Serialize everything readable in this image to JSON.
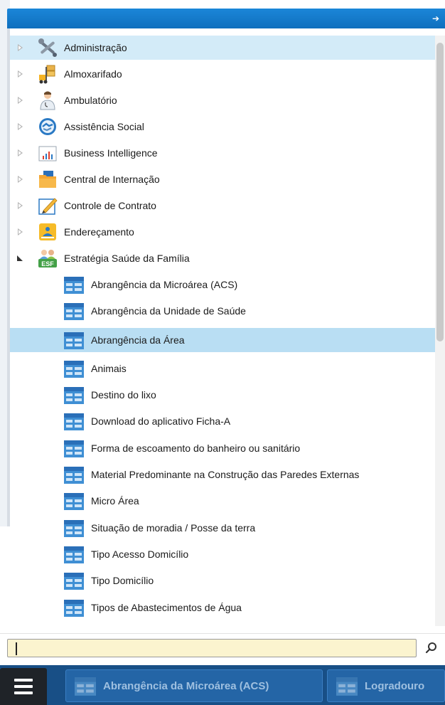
{
  "menu": {
    "modules": [
      {
        "label": "Administração",
        "icon": "tools-icon",
        "expanded": false
      },
      {
        "label": "Almoxarifado",
        "icon": "forklift-icon",
        "expanded": false
      },
      {
        "label": "Ambulatório",
        "icon": "doctor-icon",
        "expanded": false
      },
      {
        "label": "Assistência Social",
        "icon": "handshake-icon",
        "expanded": false
      },
      {
        "label": "Business Intelligence",
        "icon": "bar-chart-icon",
        "expanded": false
      },
      {
        "label": "Central de Internação",
        "icon": "folder-icon",
        "expanded": false
      },
      {
        "label": "Controle de Contrato",
        "icon": "pencil-icon",
        "expanded": false
      },
      {
        "label": "Endereçamento",
        "icon": "address-icon",
        "expanded": false
      },
      {
        "label": "Estratégia Saúde da Família",
        "icon": "family-esf-icon",
        "expanded": true
      }
    ],
    "children": [
      {
        "label": "Abrangência da Microárea (ACS)"
      },
      {
        "label": "Abrangência da Unidade de Saúde"
      },
      {
        "label": "Abrangência da Área",
        "selected": true
      },
      {
        "label": "Animais"
      },
      {
        "label": "Destino do lixo"
      },
      {
        "label": "Download do aplicativo Ficha-A"
      },
      {
        "label": "Forma de escoamento do banheiro ou sanitário"
      },
      {
        "label": "Material Predominante na Construção das Paredes Externas"
      },
      {
        "label": "Micro Área"
      },
      {
        "label": "Situação de moradia / Posse da terra"
      },
      {
        "label": "Tipo Acesso Domicílio"
      },
      {
        "label": "Tipo Domicílio"
      },
      {
        "label": "Tipos de Abastecimentos de Água"
      }
    ]
  },
  "search": {
    "value": "",
    "placeholder": ""
  },
  "taskbar": {
    "tabs": [
      {
        "label": "Abrangência da Microárea (ACS)"
      },
      {
        "label": "Logradouro"
      }
    ]
  },
  "colors": {
    "header": "#1276c8",
    "selection": "#b9def3",
    "hover": "#d3ebf8",
    "taskbar": "#184f86",
    "search_bg": "#fbf4cf"
  }
}
